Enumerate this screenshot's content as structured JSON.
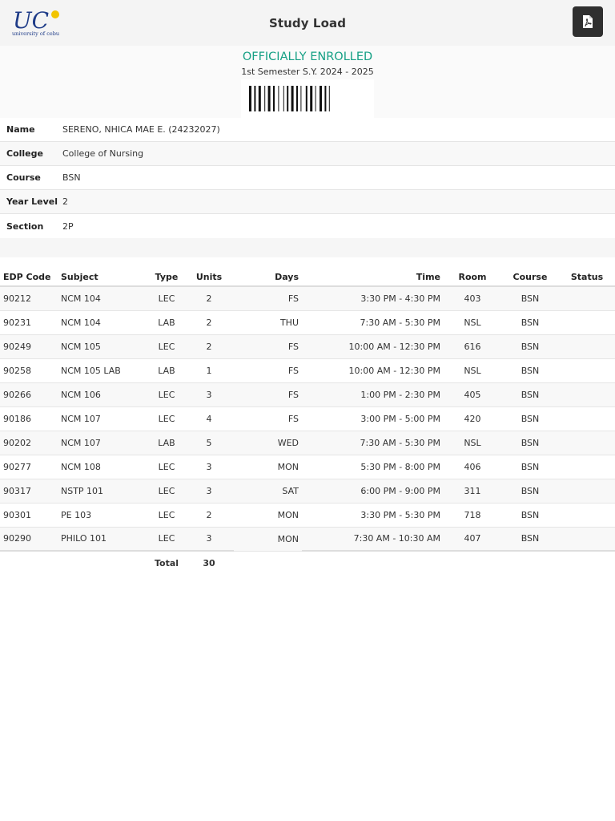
{
  "header": {
    "logo_text": "UC",
    "logo_subtext": "university of cebu",
    "title": "Study Load",
    "pdf_icon": "file-pdf-icon"
  },
  "enrollment": {
    "status": "OFFICIALLY ENROLLED",
    "semester": "1st Semester S.Y. 2024 - 2025",
    "barcode_icon": "barcode-icon"
  },
  "student": {
    "fields": [
      {
        "label": "Name",
        "value": "SERENO, NHICA MAE E. (24232027)"
      },
      {
        "label": "College",
        "value": "College of Nursing"
      },
      {
        "label": "Course",
        "value": "BSN"
      },
      {
        "label": "Year Level",
        "value": "2"
      },
      {
        "label": "Section",
        "value": "2P"
      }
    ]
  },
  "schedule": {
    "headers": {
      "edp": "EDP Code",
      "subject": "Subject",
      "type": "Type",
      "units": "Units",
      "days": "Days",
      "time": "Time",
      "room": "Room",
      "course": "Course",
      "status": "Status"
    },
    "rows": [
      {
        "edp": "90212",
        "subject": "NCM 104",
        "type": "LEC",
        "units": "2",
        "days": "FS",
        "time": "3:30 PM - 4:30 PM",
        "room": "403",
        "course": "BSN",
        "status": ""
      },
      {
        "edp": "90231",
        "subject": "NCM 104",
        "type": "LAB",
        "units": "2",
        "days": "THU",
        "time": "7:30 AM - 5:30 PM",
        "room": "NSL",
        "course": "BSN",
        "status": ""
      },
      {
        "edp": "90249",
        "subject": "NCM 105",
        "type": "LEC",
        "units": "2",
        "days": "FS",
        "time": "10:00 AM - 12:30 PM",
        "room": "616",
        "course": "BSN",
        "status": ""
      },
      {
        "edp": "90258",
        "subject": "NCM 105 LAB",
        "type": "LAB",
        "units": "1",
        "days": "FS",
        "time": "10:00 AM - 12:30 PM",
        "room": "NSL",
        "course": "BSN",
        "status": ""
      },
      {
        "edp": "90266",
        "subject": "NCM 106",
        "type": "LEC",
        "units": "3",
        "days": "FS",
        "time": "1:00 PM - 2:30 PM",
        "room": "405",
        "course": "BSN",
        "status": ""
      },
      {
        "edp": "90186",
        "subject": "NCM 107",
        "type": "LEC",
        "units": "4",
        "days": "FS",
        "time": "3:00 PM - 5:00 PM",
        "room": "420",
        "course": "BSN",
        "status": ""
      },
      {
        "edp": "90202",
        "subject": "NCM 107",
        "type": "LAB",
        "units": "5",
        "days": "WED",
        "time": "7:30 AM - 5:30 PM",
        "room": "NSL",
        "course": "BSN",
        "status": ""
      },
      {
        "edp": "90277",
        "subject": "NCM 108",
        "type": "LEC",
        "units": "3",
        "days": "MON",
        "time": "5:30 PM - 8:00 PM",
        "room": "406",
        "course": "BSN",
        "status": ""
      },
      {
        "edp": "90317",
        "subject": "NSTP 101",
        "type": "LEC",
        "units": "3",
        "days": "SAT",
        "time": "6:00 PM - 9:00 PM",
        "room": "311",
        "course": "BSN",
        "status": ""
      },
      {
        "edp": "90301",
        "subject": "PE 103",
        "type": "LEC",
        "units": "2",
        "days": "MON",
        "time": "3:30 PM - 5:30 PM",
        "room": "718",
        "course": "BSN",
        "status": ""
      },
      {
        "edp": "90290",
        "subject": "PHILO 101",
        "type": "LEC",
        "units": "3",
        "days": "MON",
        "time": "7:30 AM - 10:30 AM",
        "room": "407",
        "course": "BSN",
        "status": ""
      }
    ],
    "total_label": "Total",
    "total_units": "30"
  },
  "colors": {
    "accent": "#16a085",
    "logo_blue": "#1f3c88",
    "logo_yellow": "#f2c400",
    "button_dark": "#2f2f2f"
  }
}
